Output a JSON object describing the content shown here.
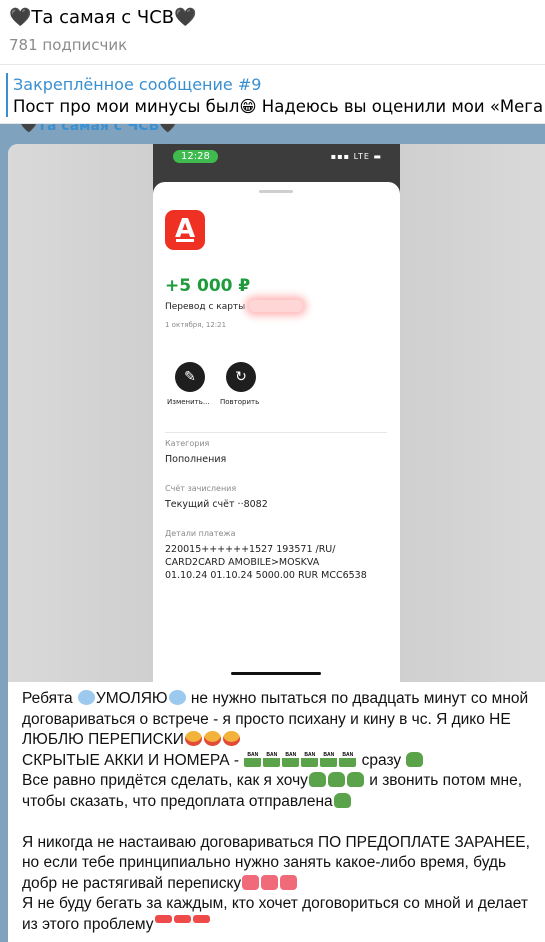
{
  "header": {
    "title": "🖤Та самая с ЧСВ🖤",
    "subtitle": "781 подписчик"
  },
  "pinned": {
    "title": "Закреплённое сообщение #9",
    "text": "Пост про мои минусы был😁 Надеюсь вы оценили мои «Мега шутки»"
  },
  "message": {
    "sender_ghost": "🖤Та самая с ЧСВ🖤",
    "receipt": {
      "status_time": "12:28",
      "status_network": "LTE",
      "amount": "+5 000 ₽",
      "transfer_label": "Перевод с карты",
      "date": "1 октября, 12:21",
      "actions": [
        {
          "label": "Изменить...",
          "icon": "pencil-icon"
        },
        {
          "label": "Повторить",
          "icon": "repeat-icon"
        }
      ],
      "category_label": "Категория",
      "category_value": "Пополнения",
      "account_label": "Счёт зачисления",
      "account_value": "Текущий счёт ··8082",
      "details_label": "Детали платежа",
      "details_lines": [
        "220015++++++1527     193571 /RU/",
        "CARD2CARD AMOBILE>MOSKVA",
        "01.10.24 01.10.24 5000.00       RUR MCC6538"
      ]
    },
    "text": {
      "p1_a": "Ребята ",
      "p1_b": "УМОЛЯЮ",
      "p1_c": " не нужно пытаться по двадцать минут со мной договариваться о встрече - я просто психану и кину в чс. Я дико НЕ ЛЮБЛЮ ПЕРЕПИСКИ",
      "p2_a": "СКРЫТЫЕ АККИ И НОМЕРА - ",
      "p2_b": " сразу ",
      "p3_a": "Все равно придётся сделать, как я хочу",
      "p3_b": " и звонить потом мне, чтобы сказать, что предоплата отправлена",
      "p4": "Я никогда не настаиваю договариваться ПО ПРЕДОПЛАТЕ ЗАРАНЕЕ, но если тебе принципиально нужно занять какое-либо время, будь добр не растягивай переписку",
      "p5": "Я не буду бегать за каждым, кто хочет договориться со мной и делает из этого проблему"
    }
  }
}
